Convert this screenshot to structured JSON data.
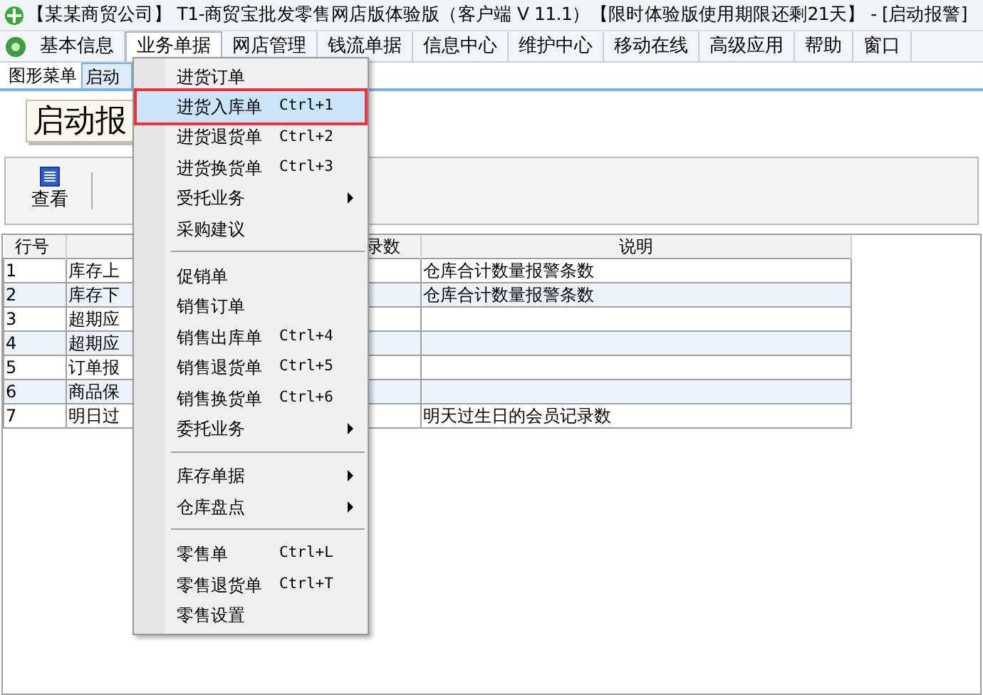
{
  "window": {
    "title": "【某某商贸公司】 T1-商贸宝批发零售网店版体验版（客户端 V 11.1）【限时体验版使用期限还剩21天】 - [启动报警]"
  },
  "menu_bar": [
    {
      "label": "基本信息",
      "selected": false
    },
    {
      "label": "业务单据",
      "selected": true
    },
    {
      "label": "网店管理",
      "selected": false
    },
    {
      "label": "钱流单据",
      "selected": false
    },
    {
      "label": "信息中心",
      "selected": false
    },
    {
      "label": "维护中心",
      "selected": false
    },
    {
      "label": "移动在线",
      "selected": false
    },
    {
      "label": "高级应用",
      "selected": false
    },
    {
      "label": "帮助",
      "selected": false
    },
    {
      "label": "窗口",
      "selected": false
    }
  ],
  "tabs": [
    {
      "label": "图形菜单",
      "selected": false
    },
    {
      "label": "启动",
      "selected": true
    }
  ],
  "panel_title": "启动报",
  "toolbar": [
    {
      "label": "查看"
    }
  ],
  "table": {
    "columns": [
      "行号",
      "",
      "录数",
      "说明"
    ],
    "rows": [
      [
        "1",
        "库存上",
        "",
        "仓库合计数量报警条数"
      ],
      [
        "2",
        "库存下",
        "",
        "仓库合计数量报警条数"
      ],
      [
        "3",
        "超期应",
        "",
        ""
      ],
      [
        "4",
        "超期应",
        "",
        ""
      ],
      [
        "5",
        "订单报",
        "",
        ""
      ],
      [
        "6",
        "商品保",
        "",
        ""
      ],
      [
        "7",
        "明日过",
        "",
        "明天过生日的会员记录数"
      ]
    ]
  },
  "dropdown_menu": [
    {
      "kind": "item",
      "label": "进货订单",
      "selected": false
    },
    {
      "kind": "item",
      "label": "进货入库单",
      "shortcut": "Ctrl+1",
      "selected": true
    },
    {
      "kind": "item",
      "label": "进货退货单",
      "shortcut": "Ctrl+2",
      "selected": false
    },
    {
      "kind": "item",
      "label": "进货换货单",
      "shortcut": "Ctrl+3",
      "selected": false
    },
    {
      "kind": "submenu",
      "label": "受托业务",
      "selected": false
    },
    {
      "kind": "item",
      "label": "采购建议",
      "selected": false
    },
    {
      "kind": "separator"
    },
    {
      "kind": "item",
      "label": "促销单",
      "selected": false
    },
    {
      "kind": "item",
      "label": "销售订单",
      "selected": false
    },
    {
      "kind": "item",
      "label": "销售出库单",
      "shortcut": "Ctrl+4",
      "selected": false
    },
    {
      "kind": "item",
      "label": "销售退货单",
      "shortcut": "Ctrl+5",
      "selected": false
    },
    {
      "kind": "item",
      "label": "销售换货单",
      "shortcut": "Ctrl+6",
      "selected": false
    },
    {
      "kind": "submenu",
      "label": "委托业务",
      "selected": false
    },
    {
      "kind": "separator"
    },
    {
      "kind": "submenu",
      "label": "库存单据",
      "selected": false
    },
    {
      "kind": "submenu",
      "label": "仓库盘点",
      "selected": false
    },
    {
      "kind": "separator"
    },
    {
      "kind": "item",
      "label": "零售单",
      "shortcut": "Ctrl+L",
      "selected": false
    },
    {
      "kind": "item",
      "label": "零售退货单",
      "shortcut": "Ctrl+T",
      "selected": false
    },
    {
      "kind": "item",
      "label": "零售设置",
      "selected": false
    }
  ]
}
